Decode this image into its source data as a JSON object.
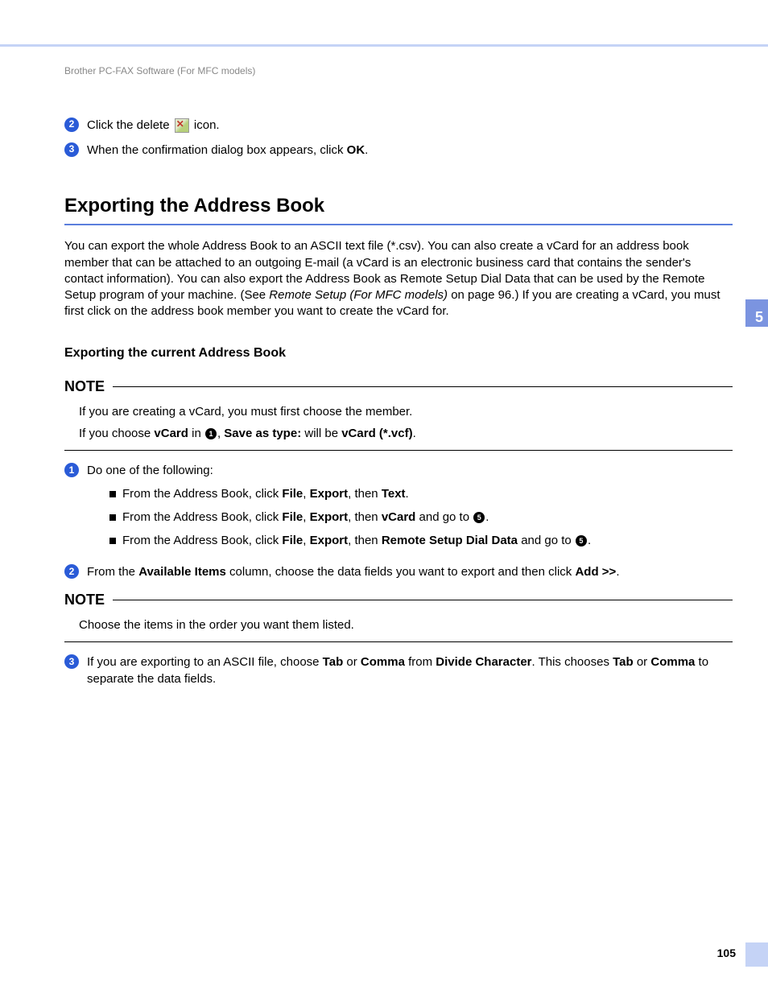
{
  "chapter_number": "5",
  "page_number": "105",
  "breadcrumb": "Brother PC-FAX Software (For MFC models)",
  "step2": {
    "pre": "Click the delete ",
    "post": " icon."
  },
  "step3": {
    "pre": "When the confirmation dialog box appears, click ",
    "bold": "OK",
    "post": "."
  },
  "section_title": "Exporting the Address Book",
  "intro": {
    "t1": "You can export the whole Address Book to an ASCII text file (*.csv). You can also create a vCard for an address book member that can be attached to an outgoing E-mail (a vCard is an electronic business card that contains the sender's contact information). You can also export the Address Book as Remote Setup Dial Data that can be used by the Remote Setup program of your machine. (See ",
    "link": "Remote Setup (For MFC models)",
    "t2": " on page 96.) If you are creating a vCard, you must first click on the address book member you want to create the vCard for."
  },
  "subheading": "Exporting the current Address Book",
  "note_label": "NOTE",
  "note1": {
    "p1": "If you are creating a vCard, you must first choose the member.",
    "p2a": "If you choose ",
    "p2b": "vCard",
    "p2c": " in ",
    "p2d": ", ",
    "p2e": "Save as type:",
    "p2f": " will be ",
    "p2g": "vCard (*.vcf)",
    "p2h": "."
  },
  "stepA": {
    "lead": "Do one of the following:",
    "i1a": "From the Address Book, click ",
    "i1b": "File",
    "i1c": ", ",
    "i1d": "Export",
    "i1e": ", then ",
    "i1f": "Text",
    "i1g": ".",
    "i2a": "From the Address Book, click ",
    "i2b": "File",
    "i2c": ", ",
    "i2d": "Export",
    "i2e": ", then ",
    "i2f": "vCard",
    "i2g": " and go to ",
    "i2h": ".",
    "i3a": "From the Address Book, click ",
    "i3b": "File",
    "i3c": ", ",
    "i3d": "Export",
    "i3e": ", then ",
    "i3f": "Remote Setup Dial Data",
    "i3g": " and go to ",
    "i3h": "."
  },
  "stepB": {
    "a": "From the ",
    "b": "Available Items",
    "c": " column, choose the data fields you want to export and then click ",
    "d": "Add >>",
    "e": "."
  },
  "note2": "Choose the items in the order you want them listed.",
  "stepC": {
    "a": "If you are exporting to an ASCII file, choose ",
    "b": "Tab",
    "c": " or ",
    "d": "Comma",
    "e": " from ",
    "f": "Divide Character",
    "g": ". This chooses ",
    "h": "Tab",
    "i": " or ",
    "j": "Comma",
    "k": " to separate the data fields."
  }
}
